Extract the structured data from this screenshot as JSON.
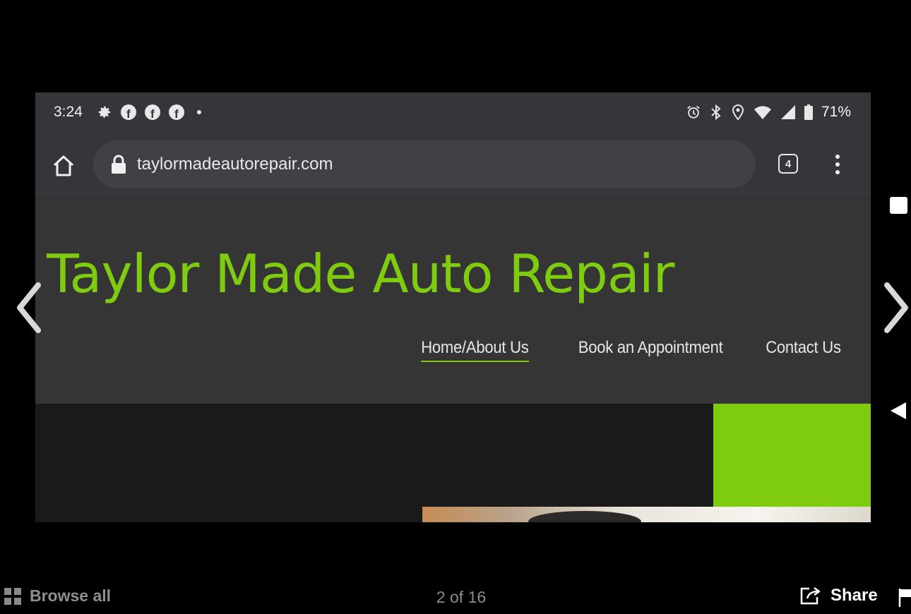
{
  "status_bar": {
    "time": "3:24",
    "battery_percent": "71%",
    "icons_left": [
      "gear-icon",
      "facebook-icon",
      "facebook-icon",
      "facebook-icon",
      "notification-dot-icon"
    ],
    "icons_right": [
      "alarm-icon",
      "bluetooth-icon",
      "location-icon",
      "wifi-icon",
      "signal-icon",
      "battery-icon"
    ]
  },
  "browser": {
    "url": "taylormadeautorepair.com",
    "tab_count": "4"
  },
  "site": {
    "title": "Taylor Made Auto Repair",
    "nav": [
      {
        "label": "Home/About Us",
        "active": true
      },
      {
        "label": "Book an Appointment",
        "active": false
      },
      {
        "label": "Contact Us",
        "active": false
      }
    ]
  },
  "viewer": {
    "browse_label": "Browse all",
    "counter": "2 of 16",
    "share_label": "Share"
  },
  "colors": {
    "brand_green": "#7ecb0f",
    "chrome_bg": "#35363a",
    "header_bg": "#353535",
    "hero_bg": "#1a1a1a"
  }
}
